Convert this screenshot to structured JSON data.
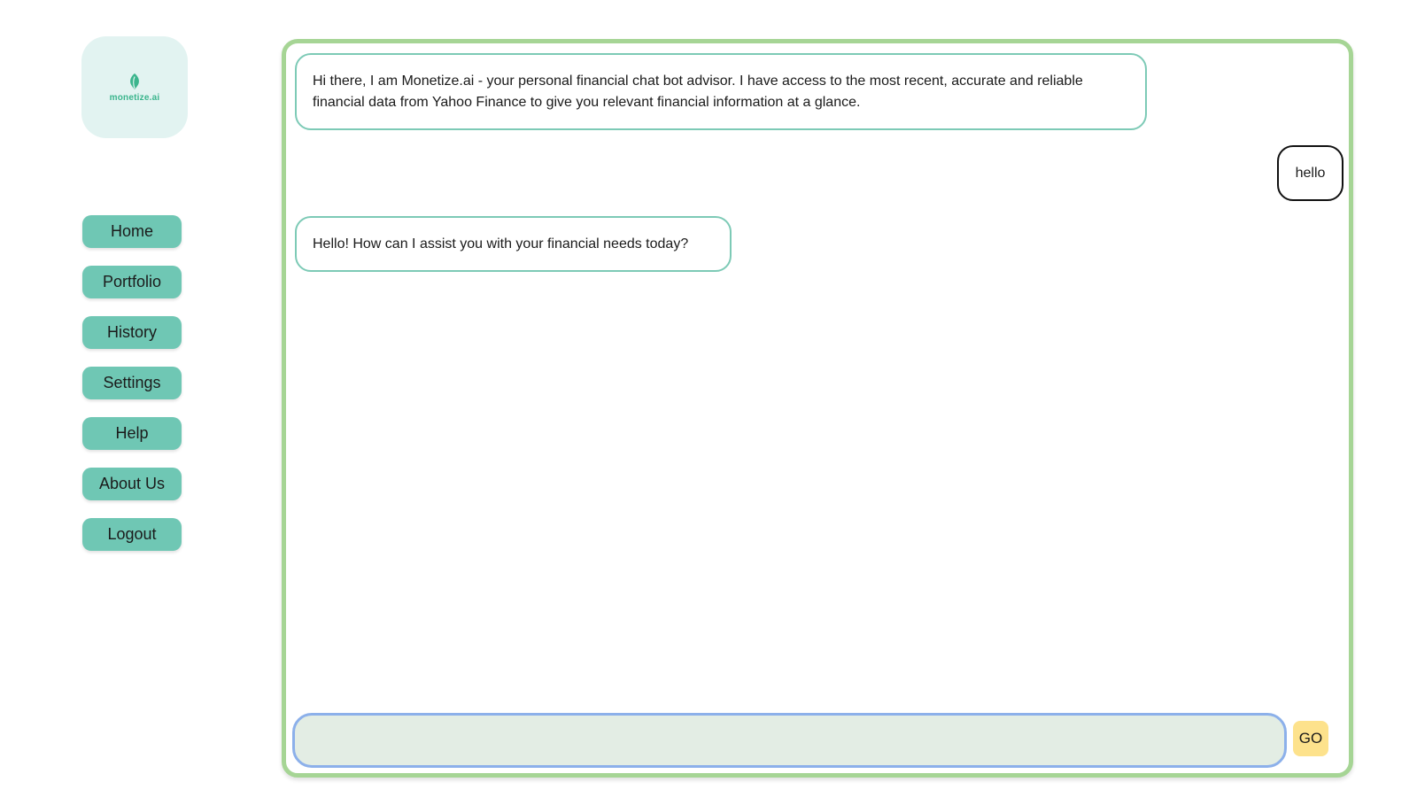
{
  "brand": {
    "logo_text": "monetize.ai",
    "logo_icon": "leaf-icon",
    "accent_color": "#3bb58d"
  },
  "sidebar": {
    "items": [
      {
        "label": "Home"
      },
      {
        "label": "Portfolio"
      },
      {
        "label": "History"
      },
      {
        "label": "Settings"
      },
      {
        "label": "Help"
      },
      {
        "label": "About Us"
      },
      {
        "label": "Logout"
      }
    ],
    "button_color": "#6fc7b4"
  },
  "chat": {
    "messages": [
      {
        "sender": "bot",
        "text": "Hi there, I am Monetize.ai - your personal financial chat bot advisor. I have access to the most recent, accurate and reliable financial data from Yahoo Finance to give you relevant financial information at a glance."
      },
      {
        "sender": "user",
        "text": "hello"
      },
      {
        "sender": "bot",
        "text": "Hello! How can I assist you with your financial needs today?"
      }
    ],
    "input": {
      "value": "",
      "placeholder": ""
    },
    "send_label": "GO",
    "panel_border_color": "#a6d595",
    "bot_bubble_border_color": "#7dcab6",
    "input_border_color": "#8cb0ea",
    "send_button_color": "#fde28c"
  }
}
